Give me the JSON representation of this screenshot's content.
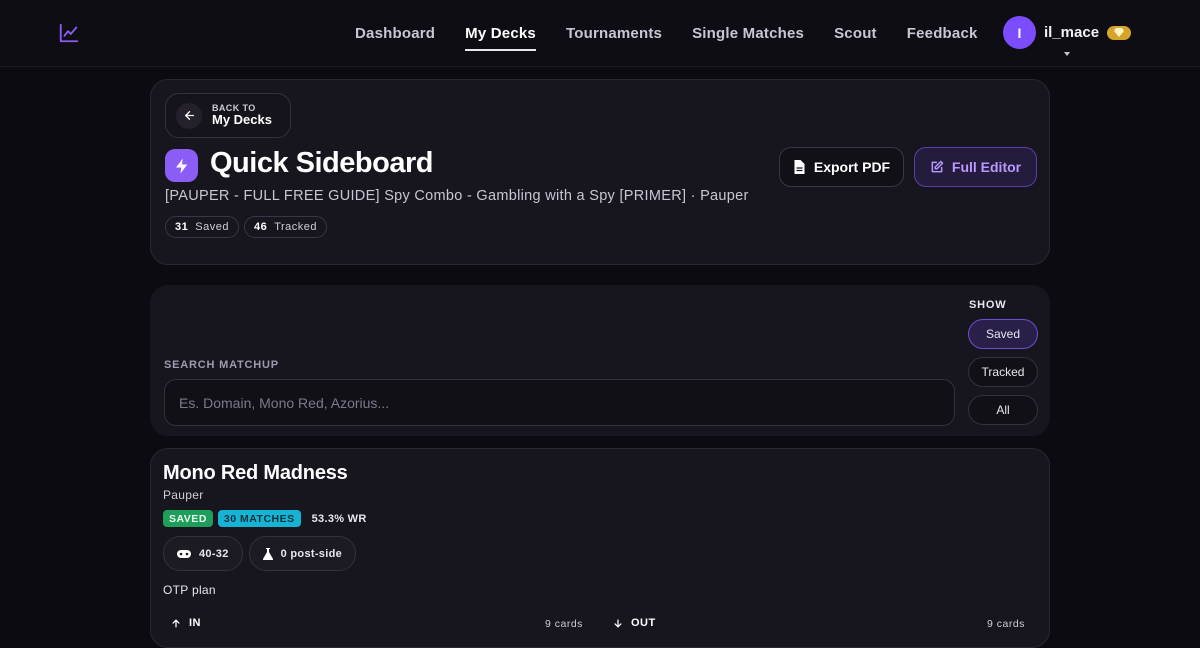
{
  "nav": {
    "logo_icon": "chart-line-icon",
    "links": [
      {
        "label": "Dashboard",
        "active": false
      },
      {
        "label": "My Decks",
        "active": true
      },
      {
        "label": "Tournaments",
        "active": false
      },
      {
        "label": "Single Matches",
        "active": false
      },
      {
        "label": "Scout",
        "active": false
      },
      {
        "label": "Feedback",
        "active": false
      }
    ],
    "user": {
      "initial": "I",
      "name": "il_mace",
      "badge_icon": "gem-icon"
    },
    "accent": "#7c4dff"
  },
  "header": {
    "back_small": "BACK TO",
    "back_big": "My Decks",
    "title": "Quick Sideboard",
    "subtitle": "[PAUPER - FULL FREE GUIDE] Spy Combo - Gambling with a Spy [PRIMER] · Pauper",
    "saved_count": "31",
    "saved_label": "Saved",
    "tracked_count": "46",
    "tracked_label": "Tracked",
    "export_label": "Export PDF",
    "editor_label": "Full Editor"
  },
  "search": {
    "label": "SEARCH MATCHUP",
    "placeholder": "Es. Domain, Mono Red, Azorius...",
    "show_label": "SHOW",
    "filters": [
      {
        "label": "Saved",
        "active": true
      },
      {
        "label": "Tracked",
        "active": false
      },
      {
        "label": "All",
        "active": false
      }
    ]
  },
  "matchup": {
    "title": "Mono Red Madness",
    "format": "Pauper",
    "saved_badge": "SAVED",
    "matches_badge": "30 MATCHES",
    "winrate": "53.3% WR",
    "record": "40-32",
    "post_side": "0 post-side",
    "plan": "OTP plan",
    "in_label": "IN",
    "in_count": "9 cards",
    "out_label": "OUT",
    "out_count": "9 cards"
  }
}
